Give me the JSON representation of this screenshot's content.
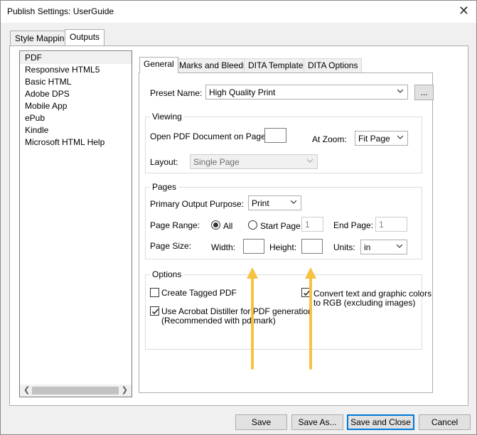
{
  "window": {
    "title": "Publish Settings: UserGuide"
  },
  "outer_tabs": [
    {
      "label": "Style Mapping"
    },
    {
      "label": "Outputs"
    }
  ],
  "outputs": {
    "items": [
      {
        "label": "PDF"
      },
      {
        "label": "Responsive HTML5"
      },
      {
        "label": "Basic HTML"
      },
      {
        "label": "Adobe DPS"
      },
      {
        "label": "Mobile App"
      },
      {
        "label": "ePub"
      },
      {
        "label": "Kindle"
      },
      {
        "label": "Microsoft HTML Help"
      }
    ]
  },
  "inner_tabs": [
    {
      "label": "General"
    },
    {
      "label": "Marks and Bleeds"
    },
    {
      "label": "DITA Template"
    },
    {
      "label": "DITA Options"
    }
  ],
  "preset": {
    "label": "Preset Name:",
    "value": "High Quality Print",
    "browse_label": "..."
  },
  "viewing": {
    "title": "Viewing",
    "open_page_label": "Open PDF Document on Page:",
    "open_page_value": "",
    "zoom_label": "At Zoom:",
    "zoom_value": "Fit Page",
    "layout_label": "Layout:",
    "layout_value": "Single Page"
  },
  "pages": {
    "title": "Pages",
    "purpose_label": "Primary Output Purpose:",
    "purpose_value": "Print",
    "range_label": "Page Range:",
    "all_label": "All",
    "start_label": "Start Page:",
    "start_value": "1",
    "end_label": "End Page:",
    "end_value": "1",
    "size_label": "Page Size:",
    "width_label": "Width:",
    "width_value": "",
    "height_label": "Height:",
    "height_value": "",
    "units_label": "Units:",
    "units_value": "in"
  },
  "options": {
    "title": "Options",
    "tagged_label": "Create Tagged PDF",
    "tagged_checked": false,
    "distiller_label_line1": "Use Acrobat Distiller for PDF generation",
    "distiller_label_line2": "(Recommended with pdfmark)",
    "distiller_checked": true,
    "rgb_label_line1": "Convert text and graphic colors",
    "rgb_label_line2": "to RGB (excluding images)",
    "rgb_checked": true
  },
  "footer": {
    "save": "Save",
    "save_as": "Save As...",
    "save_close": "Save and Close",
    "cancel": "Cancel"
  },
  "colors": {
    "annotation_arrow": "#f5c242",
    "focus_border": "#0078d7"
  }
}
